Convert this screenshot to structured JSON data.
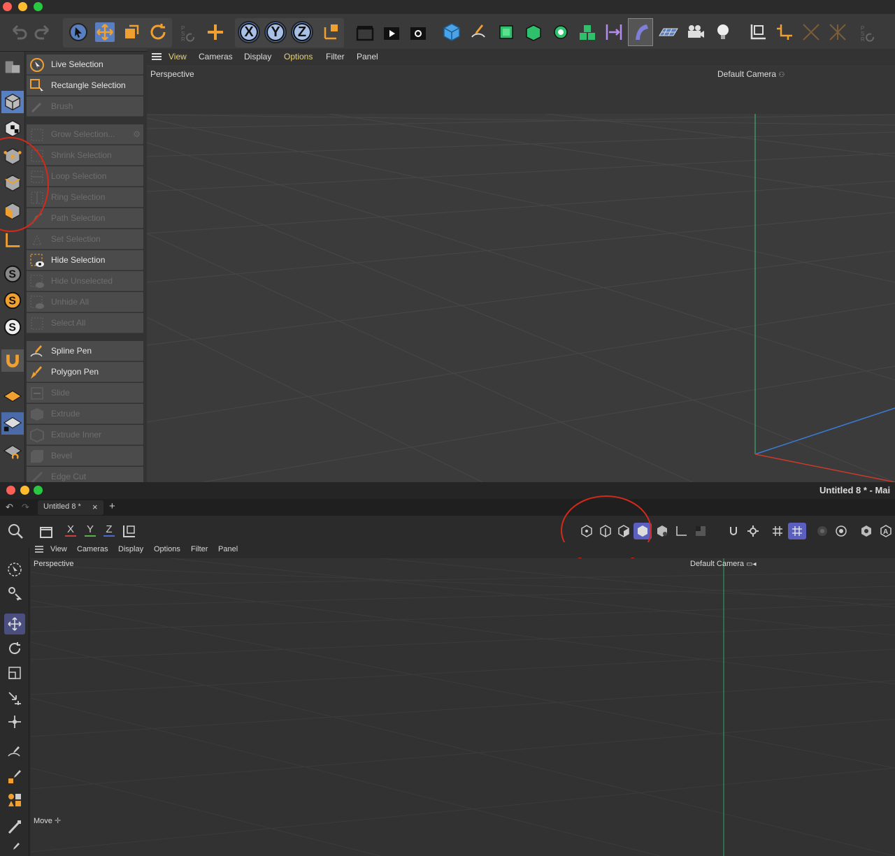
{
  "top_window": {
    "viewport_menu": [
      "View",
      "Cameras",
      "Display",
      "Options",
      "Filter",
      "Panel"
    ],
    "viewport_label": "Perspective",
    "camera_label": "Default Camera",
    "axis_buttons": [
      "X",
      "Y",
      "Z"
    ],
    "selection_menu": {
      "group1": [
        {
          "label": "Live Selection",
          "enabled": true
        },
        {
          "label": "Rectangle Selection",
          "enabled": true
        },
        {
          "label": "Brush",
          "enabled": false
        }
      ],
      "group2": [
        {
          "label": "Grow Selection...",
          "enabled": false
        },
        {
          "label": "Shrink Selection",
          "enabled": false
        },
        {
          "label": "Loop Selection",
          "enabled": false
        },
        {
          "label": "Ring Selection",
          "enabled": false
        },
        {
          "label": "Path Selection",
          "enabled": false
        },
        {
          "label": "Set Selection",
          "enabled": false
        },
        {
          "label": "Hide Selection",
          "enabled": true
        },
        {
          "label": "Hide Unselected",
          "enabled": false
        },
        {
          "label": "Unhide All",
          "enabled": false
        },
        {
          "label": "Select All",
          "enabled": false
        }
      ],
      "group3": [
        {
          "label": "Spline Pen",
          "enabled": true
        },
        {
          "label": "Polygon Pen",
          "enabled": true
        },
        {
          "label": "Slide",
          "enabled": false
        },
        {
          "label": "Extrude",
          "enabled": false
        },
        {
          "label": "Extrude Inner",
          "enabled": false
        },
        {
          "label": "Bevel",
          "enabled": false
        },
        {
          "label": "Edge Cut",
          "enabled": false
        }
      ]
    }
  },
  "bottom_window": {
    "window_title": "Untitled 8 * - Mai",
    "tab_label": "Untitled 8 *",
    "tab_close": "×",
    "tab_add": "+",
    "axis_buttons": [
      "X",
      "Y",
      "Z"
    ],
    "viewport_menu": [
      "View",
      "Cameras",
      "Display",
      "Options",
      "Filter",
      "Panel"
    ],
    "viewport_label": "Perspective",
    "camera_label": "Default Camera",
    "status_label": "Move"
  },
  "colors": {
    "accent_orange": "#f0a030",
    "accent_blue": "#5a7fc0",
    "annotation_red": "#d42a1a",
    "menu_active_yellow": "#e8d27a",
    "traffic_red": "#fe5f57",
    "traffic_yellow": "#febc2e",
    "traffic_green": "#28c840"
  }
}
